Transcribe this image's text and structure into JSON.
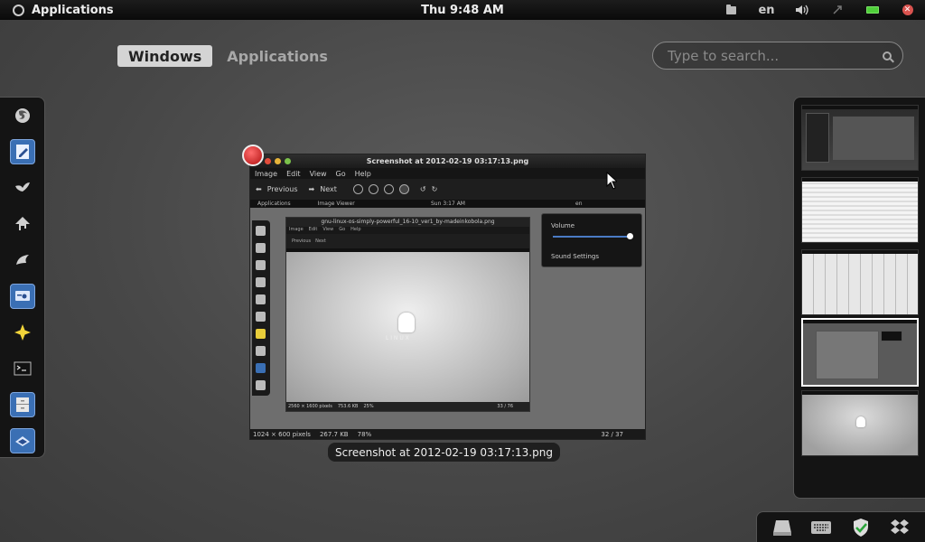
{
  "top_panel": {
    "activities_label": "Applications",
    "clock": "Thu  9:48 AM",
    "keyboard_layout": "en"
  },
  "view_selector": {
    "windows_label": "Windows",
    "applications_label": "Applications"
  },
  "search": {
    "placeholder": "Type to search..."
  },
  "dash": {
    "items": [
      {
        "name": "firefox-icon"
      },
      {
        "name": "text-editor-icon"
      },
      {
        "name": "shotwell-icon"
      },
      {
        "name": "inkscape-icon"
      },
      {
        "name": "banshee-icon"
      },
      {
        "name": "remote-desktop-icon"
      },
      {
        "name": "starred-icon"
      },
      {
        "name": "terminal-icon"
      },
      {
        "name": "file-cabinet-icon"
      },
      {
        "name": "image-viewer-icon"
      }
    ]
  },
  "window_preview": {
    "title": "Screenshot at 2012-02-19 03:17:13.png",
    "caption": "Screenshot at 2012-02-19 03:17:13.png",
    "menu": [
      "Image",
      "Edit",
      "View",
      "Go",
      "Help"
    ],
    "toolbar": {
      "previous_label": "Previous",
      "next_label": "Next"
    },
    "status": {
      "dimensions": "1024 × 600 pixels",
      "size": "267.7 KB",
      "zoom": "78%",
      "page": "32 / 37"
    },
    "inner_panel": {
      "activities_label": "Applications",
      "app_label": "Image Viewer",
      "clock": "Sun  3:17 AM",
      "lang": "en"
    },
    "inner_window": {
      "title": "gnu-linux-os-simply-powerful_16-10_ver1_by-madeinkobola.png",
      "menu": [
        "Image",
        "Edit",
        "View",
        "Go",
        "Help"
      ],
      "previous_label": "Previous",
      "next_label": "Next",
      "status": {
        "dimensions": "2560 × 1600 pixels",
        "size": "753.6 KB",
        "zoom": "25%",
        "page": "33 / 76"
      },
      "image_text": "L I N U X"
    },
    "volume_popup": {
      "label": "Volume",
      "level": 1.0,
      "settings_label": "Sound Settings"
    }
  },
  "workspaces": {
    "count": 5,
    "active_index": 3
  },
  "message_tray": {
    "items": [
      {
        "name": "removable-drive-icon"
      },
      {
        "name": "keyboard-icon"
      },
      {
        "name": "security-shield-icon"
      },
      {
        "name": "dropbox-icon"
      }
    ]
  },
  "colors": {
    "accent": "#3a6fb4",
    "panel": "#0f0f0f",
    "battery": "#4fcf3a",
    "close": "#c81818"
  }
}
